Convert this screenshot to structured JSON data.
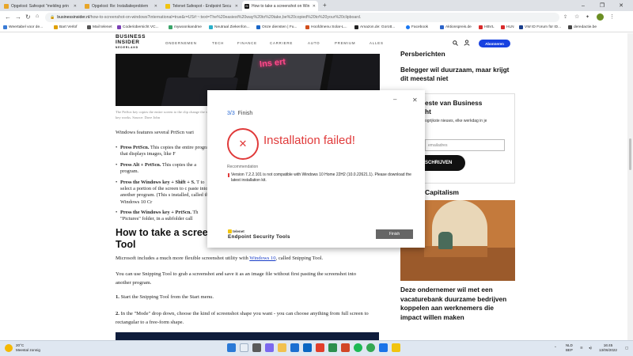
{
  "browser": {
    "tabs": [
      {
        "label": "Opgelost: Safespot \"melding prin",
        "favicon_color": "#e8a628"
      },
      {
        "label": "Opgelost: Re: Installatieproblem",
        "favicon_color": "#e8a628"
      },
      {
        "label": "Telenet Safespot - Endpoint Secu",
        "favicon_color": "#f1c40f"
      },
      {
        "label": "How to take a screenshot on Win",
        "favicon_color": "#111111",
        "favicon_text": "BI"
      }
    ],
    "new_tab": "+",
    "url_host": "businessinsider.nl",
    "url_rest": "/how-to-screenshot-on-windows?international=true&r=US#:~:text=The%20easiest%20way%20to%20take,be%20copied%20to%20your%20clipboard.",
    "bookmarks": [
      {
        "label": "Weertabel voor de...",
        "color": "#3a7bd5"
      },
      {
        "label": "Bart Verlof",
        "color": "#e0a000"
      },
      {
        "label": "Mail telenet",
        "color": "#555555"
      },
      {
        "label": "Coderiübersicht VC...",
        "color": "#7a3fb5"
      },
      {
        "label": "mywoonkandme",
        "color": "#3aa56a"
      },
      {
        "label": "Neutraal Ziekenfon...",
        "color": "#2bb0c9"
      },
      {
        "label": "Onze diensten | Fu...",
        "color": "#1a66c7"
      },
      {
        "label": "Hoofdmenu Solar-L...",
        "color": "#d14e1c"
      },
      {
        "label": "Amazon.de: Gorott...",
        "color": "#222222"
      },
      {
        "label": "Facebook",
        "color": "#1877f2"
      },
      {
        "label": "Aktionspreis.de",
        "color": "#2b63c9"
      },
      {
        "label": "HBVL",
        "color": "#d92b2b"
      },
      {
        "label": "HLN",
        "color": "#d92b2b"
      },
      {
        "label": "VW ID Forum für ID...",
        "color": "#1a3f8c"
      },
      {
        "label": "deredactie.be",
        "color": "#444444"
      }
    ]
  },
  "site": {
    "logo_line1": "BUSINESS",
    "logo_line2": "INSIDER",
    "logo_line3": "NEDERLAND",
    "menu": [
      "ONDERNEMEN",
      "TECH",
      "FINANCE",
      "CARRIERE",
      "AUTO",
      "PREMIUM",
      "ALLES"
    ],
    "subscribe": "Abonneren"
  },
  "article": {
    "hero_key_text": "Ins ert",
    "caption": "The PrtScn key copies the entire screen to the clip change the way this key works. Source: Dave John",
    "intro": "Windows features several PrtScn vari",
    "bullets": [
      {
        "bold": "Press PrtScn.",
        "text": " This copies the entire program that displays images, like F"
      },
      {
        "bold": "Press Alt + PrtScn.",
        "text": " This copies the a program."
      },
      {
        "bold": "Press the Windows key + Shift + S.",
        "text": " T to select a portion of the screen to c paste into another program. (This s installed, called the Windows 10 Cr"
      },
      {
        "bold": "Press the Windows key + PrtScn.",
        "text": " Th \"Pictures\" folder, in a subfolder call"
      }
    ],
    "heading": "How to take a scree Tool",
    "p1_before": "Microsoft includes a much more flexible screenshot utility with ",
    "p1_link": "Windows 10",
    "p1_after": ", called Snipping Tool.",
    "p2": "You can use Snipping Tool to grab a screenshot and save it as an image file without first pasting the screenshot into another program.",
    "step1_num": "1.",
    "step1": " Start the Snipping Tool from the Start menu.",
    "step2_num": "2.",
    "step2": " In the \"Mode\" drop down, choose the kind of screenshot shape you want - you can choose anything from full screen to rectangular to a free-form shape."
  },
  "sidebar": {
    "persberichten": "Persberichten",
    "press_title": "Belegger wil duurzaam, maar krijgt dit meestal niet",
    "nl_title": "este van Business",
    "nl_title2": "ht",
    "nl_desc": "ogrijkste nieuws, elke werkdag in je",
    "email_placeholder": "emailadres",
    "subscribe_btn": "SCHRIJVEN",
    "capitalism": "Capitalism",
    "article_title": "Deze ondernemer wil met een vacaturebank duurzame bedrijven koppelen aan werknemers die impact willen maken"
  },
  "modal": {
    "step_num": "3/3",
    "step_label": "Finish",
    "status_title": "Installation failed!",
    "recommendation_label": "Recommendation",
    "recommendation_text": "Version 7.2.2.101 is not compatible with Windows 10 Home 22H2 (10.0.22621.1). Please download the latest installation kit.",
    "brand_small": "telenet",
    "brand_large": "Endpoint Security Tools",
    "finish_button": "Finish"
  },
  "taskbar": {
    "temp": "20°C",
    "weather": "Meestal zonnig",
    "lang1": "NLD",
    "lang2": "BEP",
    "time": "16:45",
    "date": "13/06/2022"
  }
}
